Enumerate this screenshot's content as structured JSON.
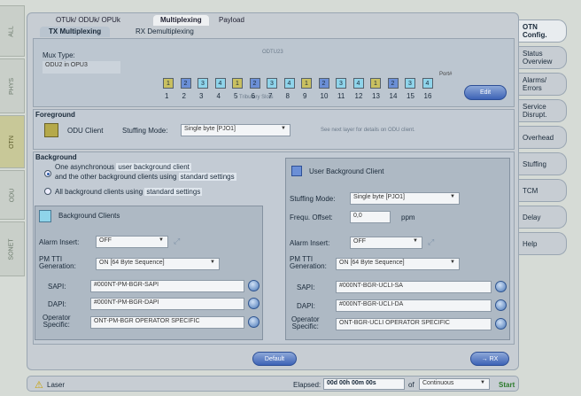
{
  "left_tabs": [
    "ALL",
    "PHYS",
    "OTN",
    "ODU",
    "SONET"
  ],
  "top_tabs": [
    "OTUk/ ODUk/ OPUk",
    "Multiplexing",
    "Payload"
  ],
  "sub_tabs": [
    "TX Multiplexing",
    "RX Demultiplexing"
  ],
  "mux": {
    "label": "Mux Type:",
    "value": "ODU2 in OPU3",
    "caption": "ODTU23",
    "slots": [
      "1",
      "2",
      "3",
      "4",
      "1",
      "2",
      "3",
      "4",
      "1",
      "2",
      "3",
      "4",
      "1",
      "2",
      "3",
      "4"
    ],
    "slot_numbers": [
      "1",
      "2",
      "3",
      "4",
      "5",
      "6",
      "7",
      "8",
      "9",
      "10",
      "11",
      "12",
      "13",
      "14",
      "15",
      "16"
    ],
    "tributary_label": "Tributary Slots",
    "port_label": "Port#",
    "edit_button": "Edit"
  },
  "foreground": {
    "title": "Foreground",
    "client_label": "ODU Client",
    "stuffing_label": "Stuffing Mode:",
    "stuffing_value": "Single byte [PJO1]",
    "hint": "See next layer for details on ODU client."
  },
  "background": {
    "title": "Background",
    "option1_line1_a": "One asynchronous",
    "option1_line1_link": "user background client",
    "option1_line2_a": "and the other background clients using",
    "option1_line2_link": "standard settings",
    "option2_a": "All background clients using",
    "option2_link": "standard settings",
    "clients_title": "Background Clients",
    "alarm_label": "Alarm Insert:",
    "alarm_value": "OFF",
    "pmtti_label1": "PM TTI",
    "pmtti_label2": "Generation:",
    "pmtti_value": "ON  [64 Byte Sequence]",
    "sapi_label": "SAPI:",
    "sapi_value": "#000NT-PM-BGR-SAPI",
    "dapi_label": "DAPI:",
    "dapi_value": "#000NT-PM-BGR-DAPI",
    "op_label1": "Operator",
    "op_label2": "Specific:",
    "op_value": "ONT-PM-BGR OPERATOR SPECIFIC"
  },
  "user_client": {
    "title": "User Background Client",
    "stuffing_label": "Stuffing Mode:",
    "stuffing_value": "Single byte [PJO1]",
    "freq_label": "Frequ. Offset:",
    "freq_value": "0,0",
    "freq_unit": "ppm",
    "alarm_label": "Alarm Insert:",
    "alarm_value": "OFF",
    "pmtti_label1": "PM TTI",
    "pmtti_label2": "Generation:",
    "pmtti_value": "ON  [64 Byte Sequence]",
    "sapi_label": "SAPI:",
    "sapi_value": "#000NT-BGR-UCLI-SA",
    "dapi_label": "DAPI:",
    "dapi_value": "#000NT-BGR-UCLI-DA",
    "op_label1": "Operator",
    "op_label2": "Specific:",
    "op_value": "ONT-BGR-UCLI OPERATOR SPECIFIC"
  },
  "buttons": {
    "default": "Default",
    "rx": "→ RX"
  },
  "right_tabs": [
    [
      "OTN",
      "Config."
    ],
    [
      "Status",
      "Overview"
    ],
    [
      "Alarms/",
      "Errors"
    ],
    [
      "Service",
      "Disrupt."
    ],
    [
      "Overhead",
      ""
    ],
    [
      "Stuffing",
      ""
    ],
    [
      "TCM",
      ""
    ],
    [
      "Delay",
      ""
    ],
    [
      "Help",
      ""
    ]
  ],
  "status": {
    "laser": "Laser",
    "elapsed_label": "Elapsed:",
    "elapsed_value": "00d 00h 00m 00s",
    "of_label": "of",
    "mode_value": "Continuous",
    "start": "Start"
  },
  "colors": {
    "slot_yellow": "#c9c060",
    "slot_blue": "#6b8fd6",
    "slot_cyan": "#8fd4ea",
    "accent_blue": "#3d63b6"
  }
}
